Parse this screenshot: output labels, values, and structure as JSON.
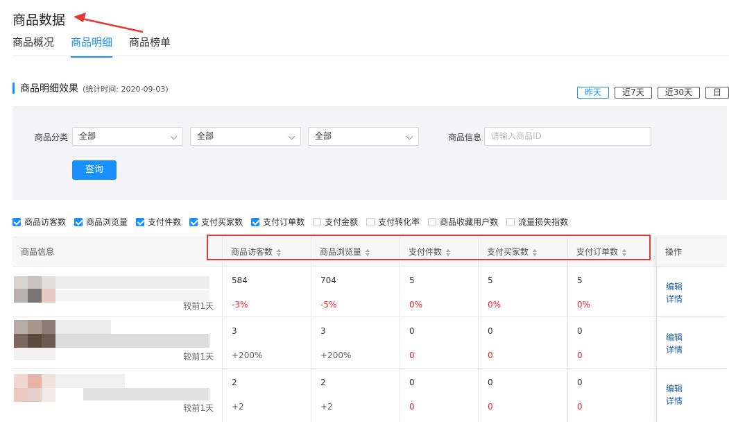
{
  "page": {
    "title": "商品数据"
  },
  "tabs": [
    {
      "label": "商品概况",
      "active": false
    },
    {
      "label": "商品明细",
      "active": true
    },
    {
      "label": "商品榜单",
      "active": false
    }
  ],
  "section": {
    "title": "商品明细效果",
    "subtitle": "(统计时间: 2020-09-03)"
  },
  "range_buttons": [
    {
      "label": "昨天",
      "active": true
    },
    {
      "label": "近7天",
      "active": false
    },
    {
      "label": "近30天",
      "active": false
    },
    {
      "label": "日",
      "active": false
    }
  ],
  "filters": {
    "category_label": "商品分类",
    "selects": [
      "全部",
      "全部",
      "全部"
    ],
    "info_label": "商品信息",
    "info_placeholder": "请输入商品ID",
    "query_label": "查询"
  },
  "columns_toggle": [
    {
      "label": "商品访客数",
      "checked": true
    },
    {
      "label": "商品浏览量",
      "checked": true
    },
    {
      "label": "支付件数",
      "checked": true
    },
    {
      "label": "支付买家数",
      "checked": true
    },
    {
      "label": "支付订单数",
      "checked": true
    },
    {
      "label": "支付金额",
      "checked": false
    },
    {
      "label": "支付转化率",
      "checked": false
    },
    {
      "label": "商品收藏用户数",
      "checked": false
    },
    {
      "label": "流量损失指数",
      "checked": false
    }
  ],
  "table": {
    "headers": [
      "商品信息",
      "商品访客数",
      "商品浏览量",
      "支付件数",
      "支付买家数",
      "支付订单数",
      "操作"
    ],
    "compare_label": "较前1天",
    "rows": [
      {
        "values": [
          "584",
          "704",
          "5",
          "5",
          "5"
        ],
        "deltas": [
          "-3%",
          "-5%",
          "0%",
          "0%",
          "0%"
        ]
      },
      {
        "values": [
          "3",
          "3",
          "0",
          "0",
          "0"
        ],
        "deltas": [
          "+200%",
          "+200%",
          "0",
          "0",
          "0"
        ]
      },
      {
        "values": [
          "2",
          "2",
          "0",
          "0",
          "0"
        ],
        "deltas": [
          "+2",
          "+2",
          "0",
          "0",
          "0"
        ]
      }
    ],
    "ops": {
      "edit": "编辑",
      "detail": "详情"
    }
  },
  "colors": {
    "accent": "#1890ff",
    "negative": "#f5222d",
    "annotation": "#e53935"
  }
}
